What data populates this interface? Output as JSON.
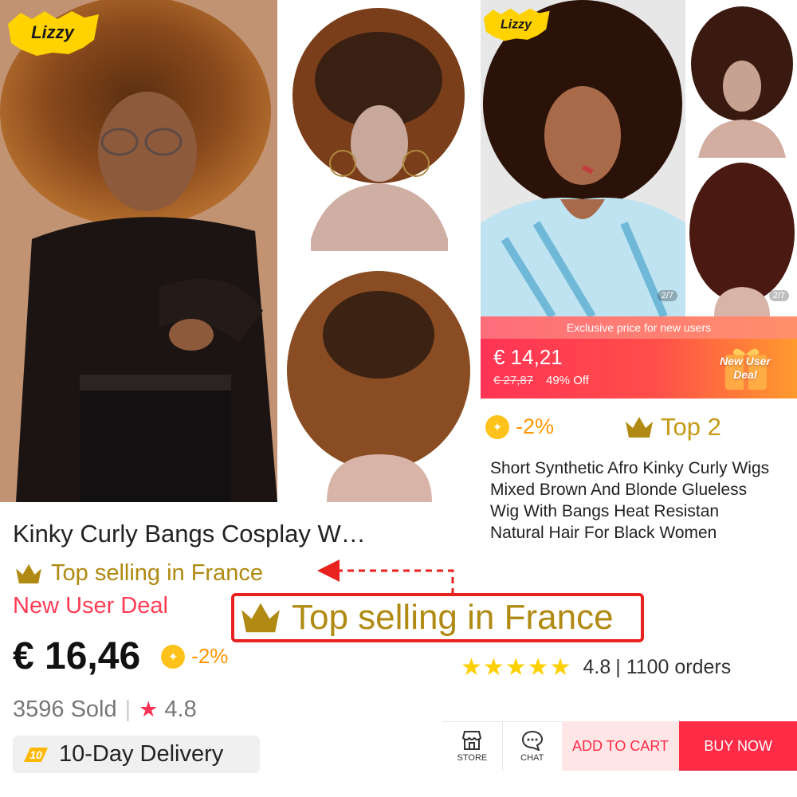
{
  "brand": {
    "logo_text": "Lizzy"
  },
  "gallery": {
    "page_indicator": "2/7"
  },
  "promo_banner": {
    "header": "Exclusive price for new users",
    "price": "€ 14,21",
    "original_price": "€ 27,87",
    "discount": "49% Off",
    "deal_label": "New User Deal"
  },
  "right_panel": {
    "coin_discount": "-2%",
    "rank": "Top 2",
    "description": "Short Synthetic Afro Kinky Curly Wigs Mixed Brown And Blonde Glueless Wig With Bangs Heat Resistan Natural Hair For Black Women"
  },
  "left_panel": {
    "title": "Kinky Curly Bangs Cosplay W…",
    "top_selling": "Top selling in France",
    "new_user_deal": "New User Deal",
    "price": "€ 16,46",
    "coin_discount": "-2%",
    "sold": "3596 Sold",
    "separator": "|",
    "rating": "4.8",
    "delivery_badge": "10",
    "delivery": "10-Day Delivery"
  },
  "callout": {
    "text": "Top selling in France"
  },
  "rating_row": {
    "stars": 5,
    "rating": "4.8",
    "orders": "| 1100 orders"
  },
  "action_bar": {
    "store_label": "STORE",
    "chat_label": "CHAT",
    "add_to_cart": "ADD TO CART",
    "buy_now": "BUY NOW"
  },
  "colors": {
    "accent_red": "#ff2b47",
    "gold": "#b08a12",
    "coin_orange": "#ff9500",
    "star_yellow": "#ffd000",
    "callout_border": "#e8231f"
  },
  "icons": [
    "crown-icon",
    "coin-icon",
    "star-icon",
    "store-icon",
    "chat-icon",
    "gift-icon",
    "delivery-icon",
    "arrow-icon"
  ]
}
